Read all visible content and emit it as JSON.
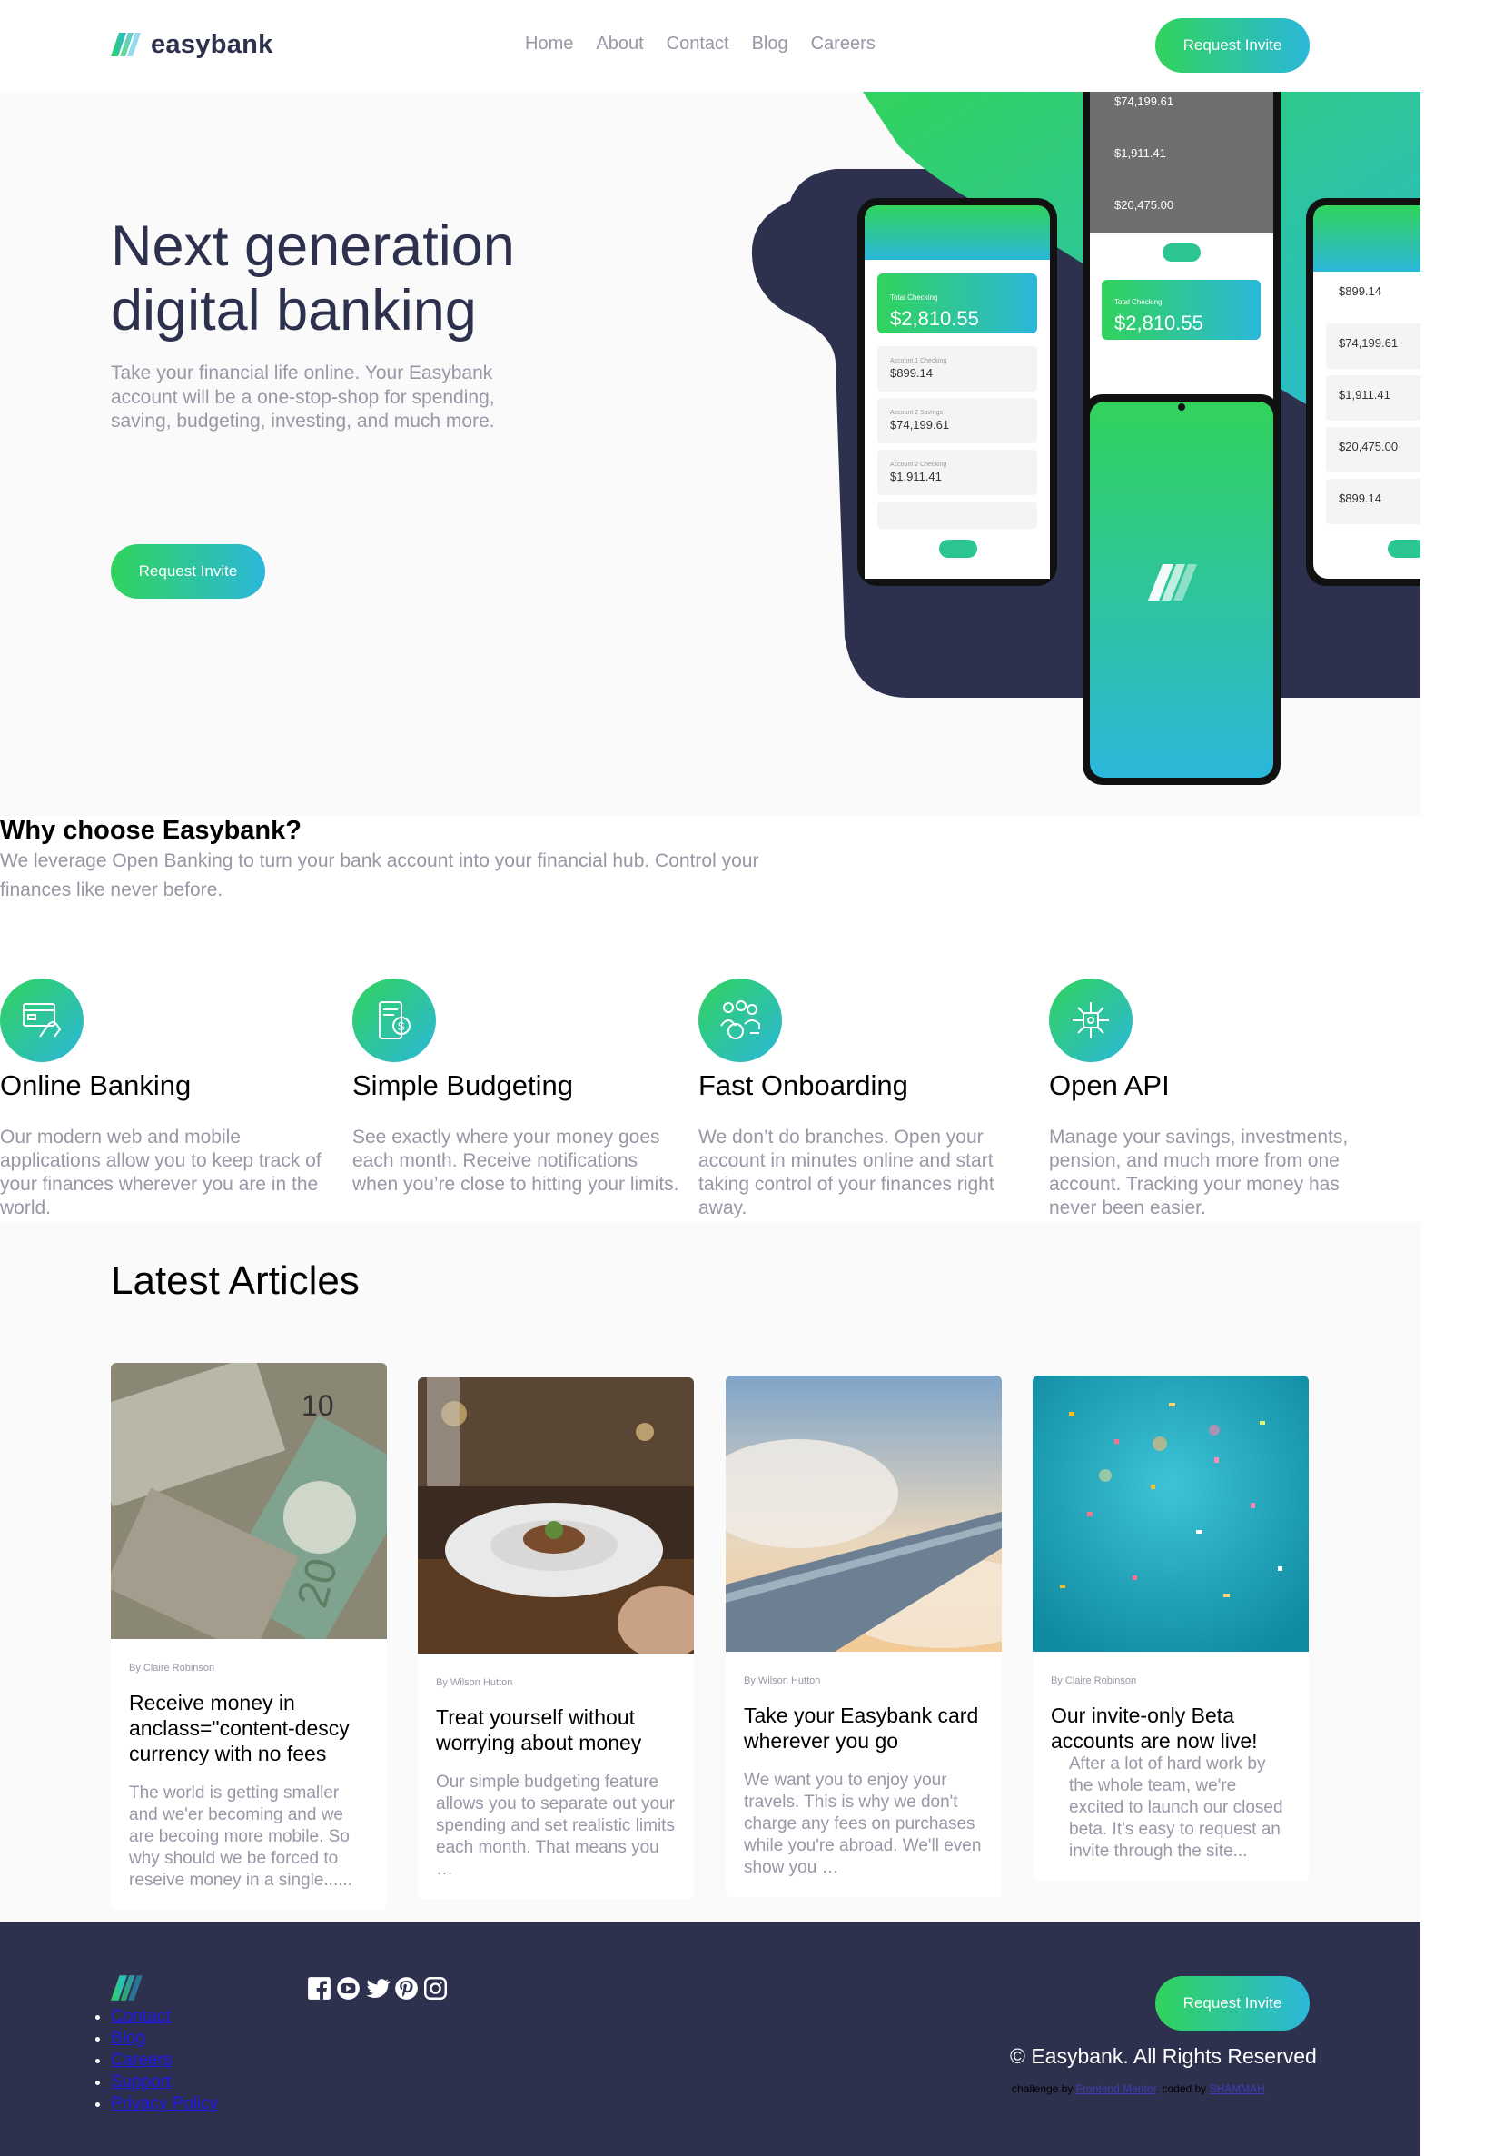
{
  "brand": {
    "name": "easybank"
  },
  "nav": {
    "items": [
      "Home",
      "About",
      "Contact",
      "Blog",
      "Careers"
    ]
  },
  "header": {
    "cta_label": "Request Invite"
  },
  "hero": {
    "title": "Next generation digital banking",
    "text": "Take your financial life online. Your Easybank account will be a one-stop-shop for spending, saving, budgeting, investing, and much more.",
    "cta_label": "Request Invite",
    "phones": {
      "total_label": "Total Checking",
      "total_amount": "$2,810.55",
      "accounts": [
        {
          "label": "Account 1 Checking",
          "amount": "$899.14"
        },
        {
          "label": "Account 2 Savings",
          "amount": "$74,199.61"
        },
        {
          "label": "Account 2 Checking",
          "amount": "$1,911.41"
        },
        {
          "label": "Account 2 Savings",
          "amount": "$20,475.00"
        },
        {
          "label": "Account 1 Checking",
          "amount": "$899.14"
        }
      ]
    }
  },
  "why": {
    "title": "Why choose Easybank?",
    "text": "We leverage Open Banking to turn your bank account into your financial hub. Control your finances like never before.",
    "features": [
      {
        "icon": "online-banking-icon",
        "title": "Online Banking",
        "text": "Our modern web and mobile applications allow you to keep track of your finances wherever you are in the world."
      },
      {
        "icon": "budgeting-icon",
        "title": "Simple Budgeting",
        "text": "See exactly where your money goes each month. Receive notifications when you’re close to hitting your limits."
      },
      {
        "icon": "onboarding-icon",
        "title": "Fast Onboarding",
        "text": "We don’t do branches. Open your account in minutes online and start taking control of your finances right away."
      },
      {
        "icon": "api-icon",
        "title": "Open API",
        "text": "Manage your savings, investments, pension, and much more from one account. Tracking your money has never been easier."
      }
    ]
  },
  "articles": {
    "title": "Latest Articles",
    "items": [
      {
        "author": "By Claire Robinson",
        "title": "Receive money in anclass=\"content-descy currency with no fees",
        "text": "The world is getting smaller and we'er becoming and we are becoing more mobile. So why should we be forced to reseive money in a single......",
        "image": "currency-photo"
      },
      {
        "author": "By Wilson Hutton",
        "title": "Treat yourself without worrying about money",
        "text": "Our simple budgeting feature allows you to separate out your spending and set realistic limits each month. That means you …",
        "image": "restaurant-photo"
      },
      {
        "author": "By Wilson Hutton",
        "title": "Take your Easybank card wherever you go",
        "text": "We want you to enjoy your travels. This is why we don't charge any fees on purchases while you're abroad. We'll even show you …",
        "image": "plane-photo"
      },
      {
        "author": "By Claire Robinson",
        "title": "Our invite-only Beta accounts are now live!",
        "text": "After a lot of hard work by the whole team, we're excited to launch our closed beta. It's easy to request an invite through the site...",
        "image": "confetti-photo"
      }
    ]
  },
  "footer": {
    "links": [
      "Contact",
      "Blog",
      "Careers",
      "Support",
      "Privacy Policy"
    ],
    "social_icons": [
      "facebook-icon",
      "youtube-icon",
      "twitter-icon",
      "pinterest-icon",
      "instagram-icon"
    ],
    "cta_label": "Request Invite",
    "copyright": "© Easybank. All Rights Reserved",
    "attrib_prefix": "challenge by",
    "attrib_fm": "Frontend Mentor",
    "attrib_mid": ". coded by",
    "attrib_author": "SHAMMAH"
  },
  "colors": {
    "dark_blue": "#2d314d",
    "lime_green": "#31d35c",
    "bright_cyan": "#2bb7da",
    "grayish_blue": "#9698a6"
  }
}
